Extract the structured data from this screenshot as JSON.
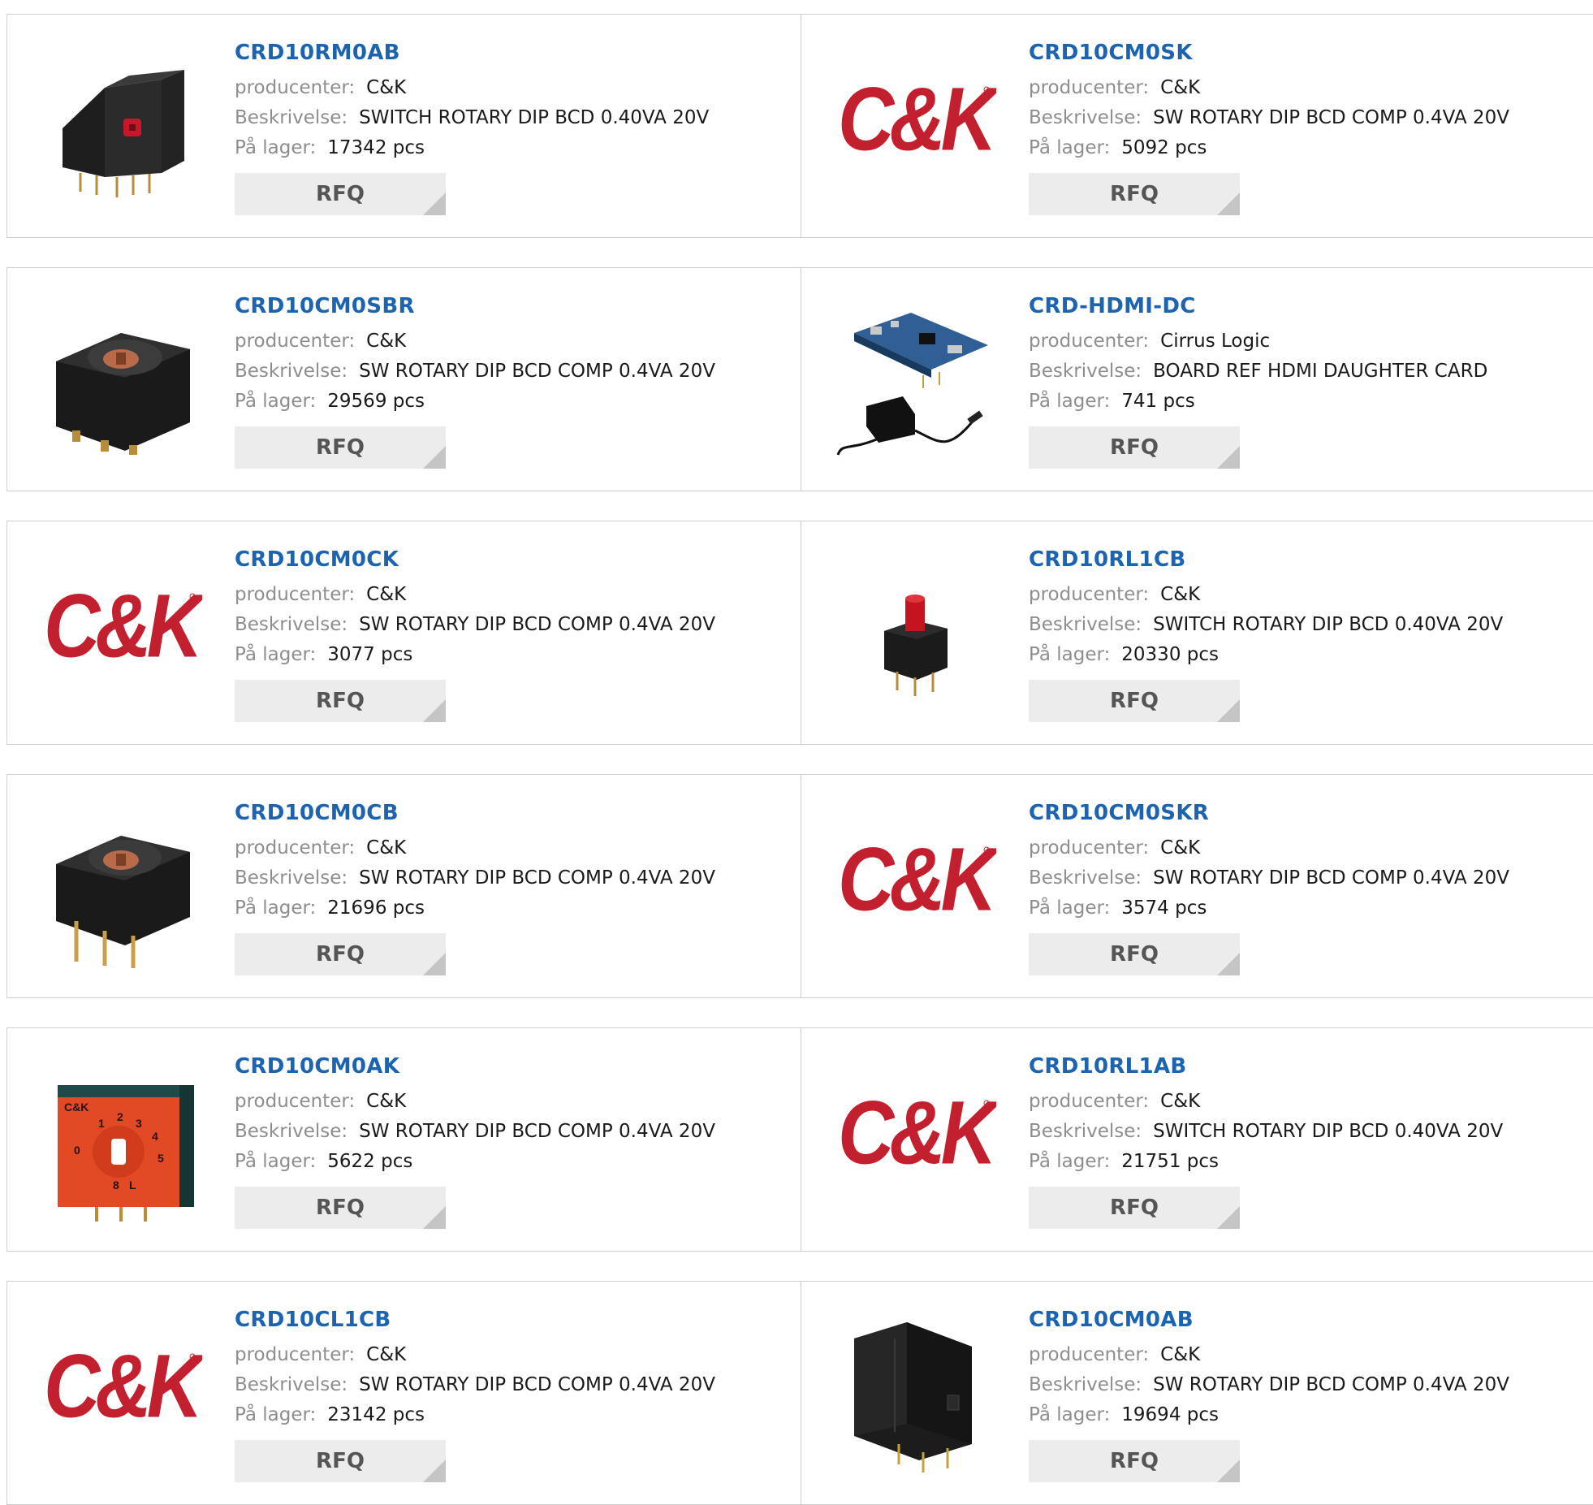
{
  "labels": {
    "manufacturer": "producenter:",
    "description": "Beskrivelse:",
    "stock": "På lager:",
    "rfq": "RFQ",
    "logo_text": "C&K"
  },
  "colors": {
    "link": "#1c63b0",
    "label": "#8e8e8e",
    "button_bg": "#ececec",
    "logo_red": "#c3202f"
  },
  "products": [
    {
      "part": "CRD10RM0AB",
      "manufacturer": "C&K",
      "description": "SWITCH ROTARY DIP BCD 0.40VA 20V",
      "stock": "17342 pcs",
      "image": "right-angle-dip-switch-photo"
    },
    {
      "part": "CRD10CM0SK",
      "manufacturer": "C&K",
      "description": "SW ROTARY DIP BCD COMP 0.4VA 20V",
      "stock": "5092 pcs",
      "image": "ck-logo"
    },
    {
      "part": "CRD10CM0SBR",
      "manufacturer": "C&K",
      "description": "SW ROTARY DIP BCD COMP 0.4VA 20V",
      "stock": "29569 pcs",
      "image": "rotary-switch-smd-photo"
    },
    {
      "part": "CRD-HDMI-DC",
      "manufacturer": "Cirrus Logic",
      "description": "BOARD REF HDMI DAUGHTER CARD",
      "stock": "741 pcs",
      "image": "hdmi-board-with-adapter-photo"
    },
    {
      "part": "CRD10CM0CK",
      "manufacturer": "C&K",
      "description": "SW ROTARY DIP BCD COMP 0.4VA 20V",
      "stock": "3077 pcs",
      "image": "ck-logo"
    },
    {
      "part": "CRD10RL1CB",
      "manufacturer": "C&K",
      "description": "SWITCH ROTARY DIP BCD 0.40VA 20V",
      "stock": "20330 pcs",
      "image": "rotary-switch-red-shaft-photo"
    },
    {
      "part": "CRD10CM0CB",
      "manufacturer": "C&K",
      "description": "SW ROTARY DIP BCD COMP 0.4VA 20V",
      "stock": "21696 pcs",
      "image": "rotary-switch-through-hole-photo"
    },
    {
      "part": "CRD10CM0SKR",
      "manufacturer": "C&K",
      "description": "SW ROTARY DIP BCD COMP 0.4VA 20V",
      "stock": "3574 pcs",
      "image": "ck-logo"
    },
    {
      "part": "CRD10CM0AK",
      "manufacturer": "C&K",
      "description": "SW ROTARY DIP BCD COMP 0.4VA 20V",
      "stock": "5622 pcs",
      "image": "orange-rotary-switch-photo"
    },
    {
      "part": "CRD10RL1AB",
      "manufacturer": "C&K",
      "description": "SWITCH ROTARY DIP BCD 0.40VA 20V",
      "stock": "21751 pcs",
      "image": "ck-logo"
    },
    {
      "part": "CRD10CL1CB",
      "manufacturer": "C&K",
      "description": "SW ROTARY DIP BCD COMP 0.4VA 20V",
      "stock": "23142 pcs",
      "image": "ck-logo"
    },
    {
      "part": "CRD10CM0AB",
      "manufacturer": "C&K",
      "description": "SW ROTARY DIP BCD COMP 0.4VA 20V",
      "stock": "19694 pcs",
      "image": "black-right-angle-switch-photo"
    }
  ]
}
